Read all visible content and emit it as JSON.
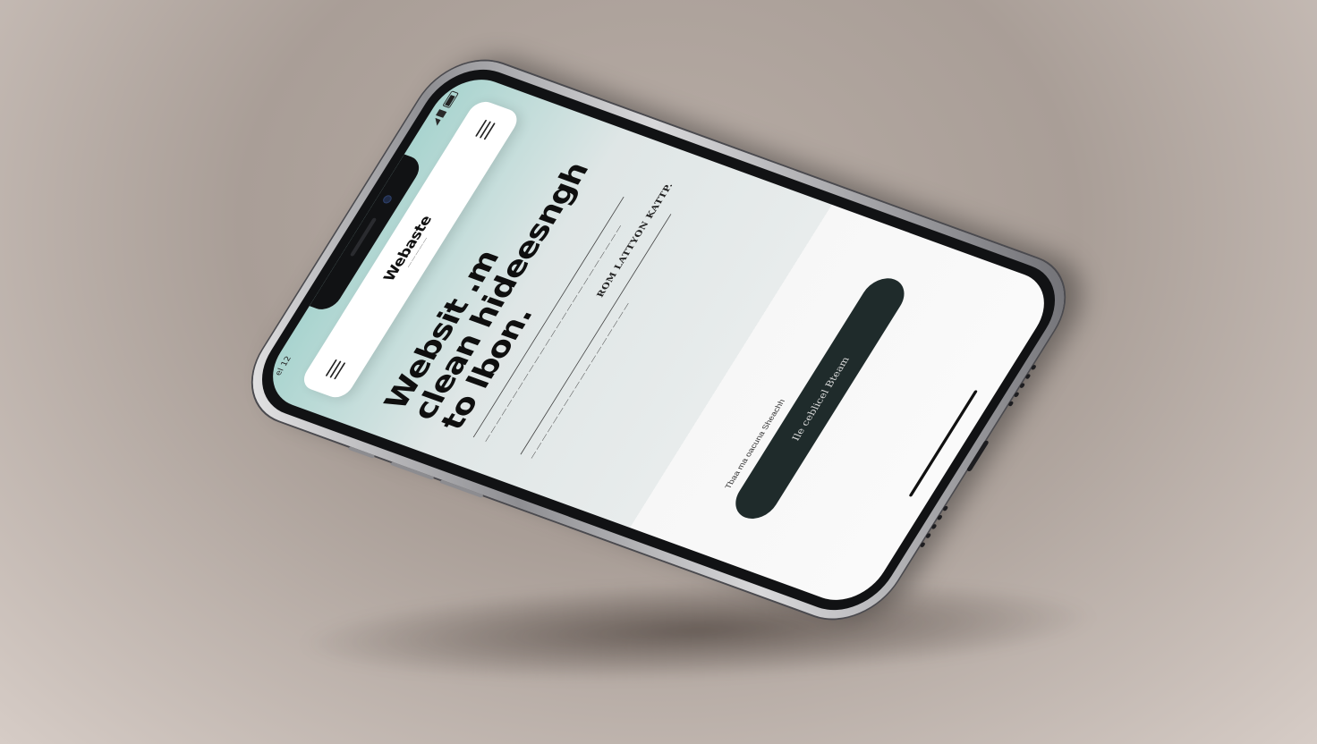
{
  "status_bar": {
    "time": "el 12",
    "signal": "◢ ▇"
  },
  "navbar": {
    "brand_name": "Webaste",
    "brand_sub": "—————"
  },
  "hero": {
    "title": "Websit .m\nclean hideesngh\nto lbon.",
    "body_1": "— — — — — — — — — — — — — — — — — — — — — — — — —",
    "cta_label": "ROM LATTYON KATTP.",
    "body_2": "— — — — — — — — — — — — — — — — — —"
  },
  "bottom": {
    "caption": "Tbaa ma oacuna Sheachh",
    "button_label": "Ile ceblicel Bteam"
  },
  "colors": {
    "screen_top": "#a9d4cf",
    "screen_mid": "#e8ecec",
    "button_bg": "#1f2b2b",
    "background": "#ada29b"
  },
  "icons": {
    "menu": "hamburger-icon",
    "menu_right": "hamburger-icon"
  }
}
